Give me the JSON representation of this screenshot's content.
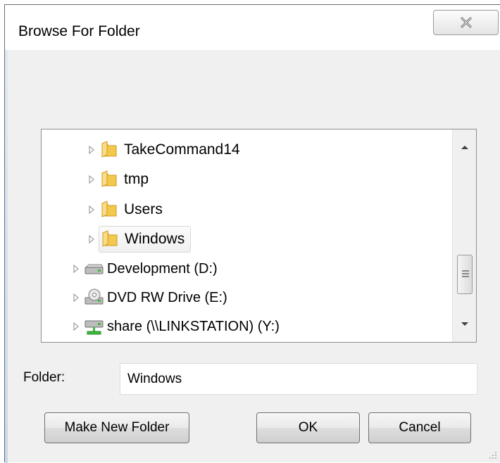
{
  "dialog": {
    "title": "Browse For Folder",
    "close_icon": "close-icon"
  },
  "tree": {
    "items": [
      {
        "label": "TakeCommand14",
        "icon": "folder-icon"
      },
      {
        "label": "tmp",
        "icon": "folder-icon"
      },
      {
        "label": "Users",
        "icon": "folder-icon"
      },
      {
        "label": "Windows",
        "icon": "folder-icon",
        "selected": true
      },
      {
        "label": "Development (D:)",
        "icon": "hard-drive-icon"
      },
      {
        "label": "DVD RW Drive (E:)",
        "icon": "dvd-drive-icon"
      },
      {
        "label": "share (\\\\LINKSTATION) (Y:)",
        "icon": "network-drive-icon"
      }
    ]
  },
  "folder": {
    "label": "Folder:",
    "value": "Windows"
  },
  "buttons": {
    "make_new_folder": "Make New Folder",
    "ok": "OK",
    "cancel": "Cancel"
  },
  "colors": {
    "folder_yellow": "#f2c94c",
    "selection_border": "#d9d9d9"
  }
}
